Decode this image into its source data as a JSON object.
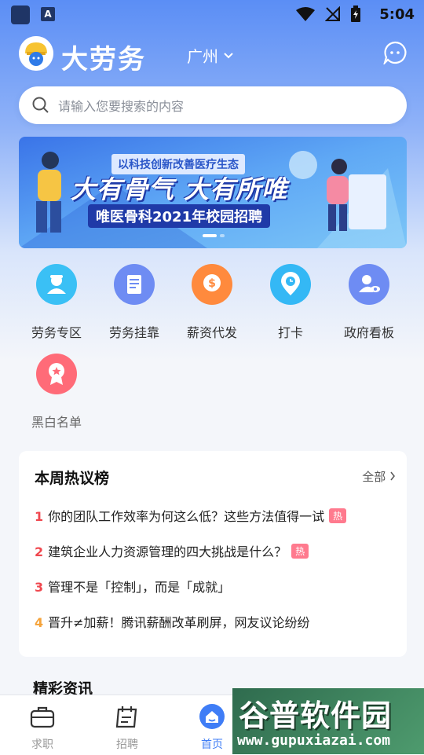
{
  "status_bar": {
    "time": "5:04",
    "badge_letter": "A"
  },
  "header": {
    "app_name": "大劳务",
    "city": "广州"
  },
  "search": {
    "placeholder": "请输入您要搜索的内容"
  },
  "banner": {
    "tag": "以科技创新改善医疗生态",
    "headline": "大有骨气 大有所唯",
    "subline": "唯医骨科2021年校园招聘",
    "slide_count": 2,
    "active_slide": 1
  },
  "services": [
    {
      "label": "劳务专区",
      "icon": "worker-icon",
      "color": "#3ac0f5"
    },
    {
      "label": "劳务挂靠",
      "icon": "document-icon",
      "color": "#6e8cf3"
    },
    {
      "label": "薪资代发",
      "icon": "coin-icon",
      "color": "#ff8a3d"
    },
    {
      "label": "打卡",
      "icon": "location-clock-icon",
      "color": "#34b8f5"
    },
    {
      "label": "政府看板",
      "icon": "user-eye-icon",
      "color": "#6e8cf3"
    },
    {
      "label": "黑白名单",
      "icon": "badge-icon",
      "color": "#ff6b78"
    }
  ],
  "hot": {
    "title": "本周热议榜",
    "all_label": "全部",
    "badge_label": "热",
    "items": [
      {
        "num": "1",
        "text": "你的团队工作效率为何这么低？这些方法值得一试",
        "hot": true,
        "color": "#f0484f"
      },
      {
        "num": "2",
        "text": "建筑企业人力资源管理的四大挑战是什么？",
        "hot": true,
        "color": "#f0484f"
      },
      {
        "num": "3",
        "text": "管理不是「控制」，而是「成就」",
        "hot": false,
        "color": "#f0484f"
      },
      {
        "num": "4",
        "text": "晋升≠加薪！腾讯薪酬改革刷屏，网友议论纷纷",
        "hot": false,
        "color": "#f5a33b"
      }
    ]
  },
  "section_news": {
    "title": "精彩资讯"
  },
  "tabbar": {
    "tabs": [
      {
        "label": "求职",
        "icon": "briefcase-icon",
        "active": false
      },
      {
        "label": "招聘",
        "icon": "calendar-icon",
        "active": false
      },
      {
        "label": "首页",
        "icon": "home-icon",
        "active": true
      }
    ]
  },
  "watermark": {
    "title": "谷普软件园",
    "url": "www.gupuxiazai.com"
  },
  "colors": {
    "accent": "#3f7df6",
    "hero_top": "#5b8ef5",
    "hot_badge": "#ff7a8e"
  }
}
